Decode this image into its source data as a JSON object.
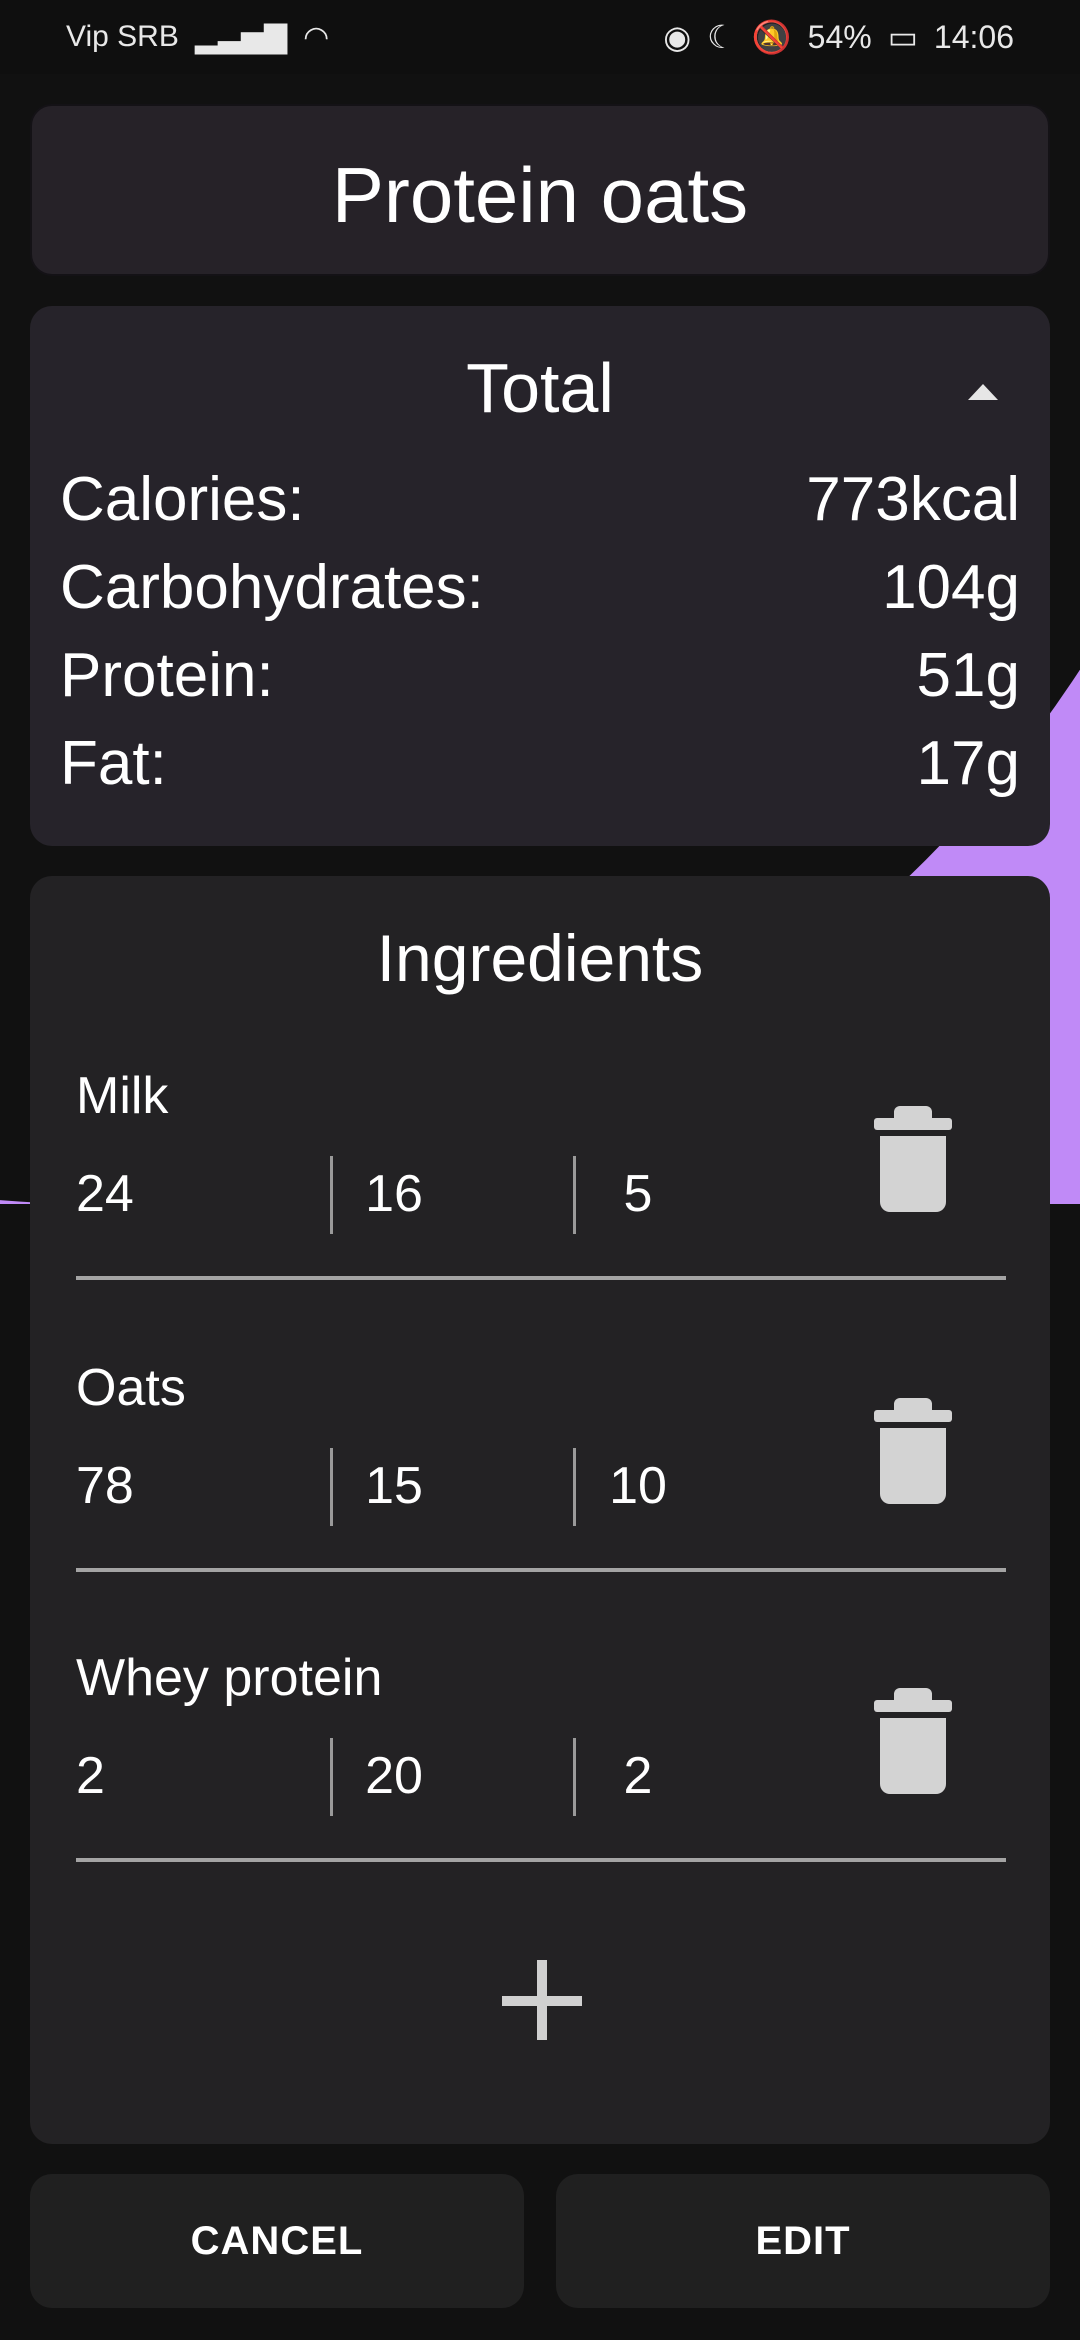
{
  "status_bar": {
    "carrier": "Vip SRB",
    "battery": "54%",
    "time": "14:06"
  },
  "recipe": {
    "title": "Protein oats"
  },
  "total": {
    "heading": "Total",
    "rows": [
      {
        "label": "Calories:",
        "value": "773kcal"
      },
      {
        "label": "Carbohydrates:",
        "value": "104g"
      },
      {
        "label": "Protein:",
        "value": "51g"
      },
      {
        "label": "Fat:",
        "value": "17g"
      }
    ]
  },
  "ingredients": {
    "heading": "Ingredients",
    "items": [
      {
        "name": "Milk",
        "values": [
          "24",
          "16",
          "5"
        ]
      },
      {
        "name": "Oats",
        "values": [
          "78",
          "15",
          "10"
        ]
      },
      {
        "name": "Whey protein",
        "values": [
          "2",
          "20",
          "2"
        ]
      }
    ]
  },
  "buttons": {
    "cancel": "CANCEL",
    "edit": "EDIT"
  },
  "colors": {
    "accent": "#c08af7",
    "card": "#26232a",
    "background": "#111111"
  }
}
